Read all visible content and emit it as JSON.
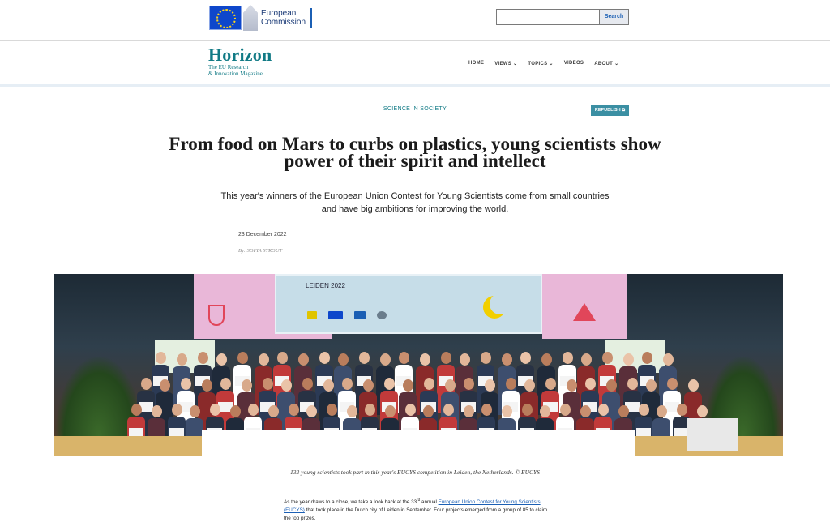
{
  "ec": {
    "name_line1": "European",
    "name_line2": "Commission"
  },
  "search": {
    "placeholder": "",
    "button": "Search"
  },
  "brand": {
    "name": "Horizon",
    "tag_line1": "The EU Research",
    "tag_line2": "& Innovation Magazine"
  },
  "nav": {
    "items": [
      "HOME",
      "VIEWS",
      "TOPICS",
      "VIDEOS",
      "ABOUT"
    ]
  },
  "article": {
    "category": "SCIENCE IN SOCIETY",
    "republish": "REPUBLISH",
    "title": "From food on Mars to curbs on plastics, young scientists show power of their spirit and intellect",
    "lead": "This year's winners of the European Union Contest for Young Scientists come from small countries and have big ambitions for improving the world.",
    "date": "23 December 2022",
    "byline": "By: SOFIA STROUT",
    "photo_screen_title": "LEIDEN 2022",
    "caption": "132 young scientists took part in this year's EUCYS competition in Leiden, the Netherlands. © EUCYS",
    "body_pre": "As the year draws to a close, we take a look back at the 33",
    "body_sup": "rd",
    "body_mid": " annual ",
    "body_link": "European Union Contest for Young Scientists (EUCYS)",
    "body_post": " that took place in the Dutch city of Leiden in September. Four projects emerged from a group of 85 to claim the top prizes."
  },
  "colors": {
    "brand_teal": "#117a85",
    "ec_blue": "#0e47cb",
    "republish_bg": "#3b8fa3"
  }
}
